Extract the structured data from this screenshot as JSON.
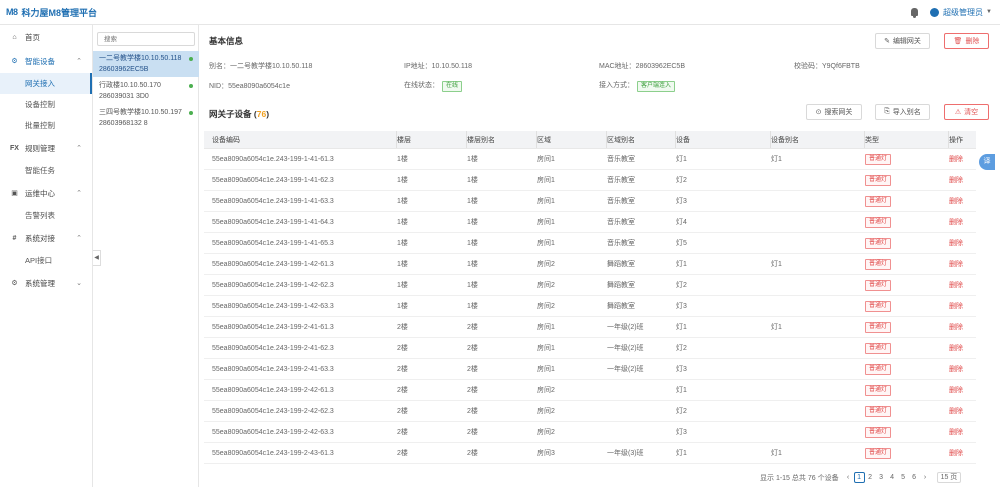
{
  "app": {
    "logo": "M8",
    "title": "科力屋M8管理平台",
    "user": "超级管理员"
  },
  "nav": {
    "home": "首页",
    "smart": "智能设备",
    "gateway_access": "网关接入",
    "device_control": "设备控制",
    "batch_control": "批量控制",
    "rules": "规则管理",
    "smart_tasks": "智能任务",
    "ops": "运维中心",
    "alarms": "告警列表",
    "integration": "系统对接",
    "api": "API接口",
    "system": "系统管理",
    "rules_prefix": "FX"
  },
  "gateways": {
    "search_placeholder": "搜索",
    "items": [
      {
        "name": "一二号教学楼10.10.50.118",
        "mac": "28603962EC5B"
      },
      {
        "name": "行政楼10.10.50.170",
        "mac": "286039031 3D0"
      },
      {
        "name": "三四号教学楼10.10.50.197",
        "mac": "28603968132 8"
      }
    ]
  },
  "basic": {
    "title": "基本信息",
    "edit_btn": "编辑网关",
    "delete_btn": "删除",
    "alias_label": "别名：",
    "alias": "一二号教学楼10.10.50.118",
    "ip_label": "IP地址：",
    "ip": "10.10.50.118",
    "mac_label": "MAC地址：",
    "mac": "28603962EC5B",
    "check_label": "校验码：",
    "check": "Y9Qf6FBTB",
    "nid_label": "NID：",
    "nid": "55ea8090a6054c1e",
    "status_label": "在线状态：",
    "status": "在线",
    "access_label": "接入方式：",
    "access": "客户端连入"
  },
  "sub": {
    "title": "网关子设备",
    "count": "76",
    "search_btn": "搜索网关",
    "import_btn": "导入别名",
    "clear_btn": "清空"
  },
  "table": {
    "headers": [
      "设备编码",
      "楼层",
      "楼层别名",
      "区域",
      "区域别名",
      "设备",
      "设备别名",
      "类型",
      "操作"
    ],
    "type_label": "普通灯",
    "op_label": "删除",
    "rows": [
      {
        "code": "55ea8090a6054c1e.243-199-1-41-61.3",
        "floor": "1楼",
        "floor_alias": "1楼",
        "area": "房间1",
        "area_alias": "音乐教室",
        "device": "灯1",
        "device_alias": "灯1"
      },
      {
        "code": "55ea8090a6054c1e.243-199-1-41-62.3",
        "floor": "1楼",
        "floor_alias": "1楼",
        "area": "房间1",
        "area_alias": "音乐教室",
        "device": "灯2",
        "device_alias": ""
      },
      {
        "code": "55ea8090a6054c1e.243-199-1-41-63.3",
        "floor": "1楼",
        "floor_alias": "1楼",
        "area": "房间1",
        "area_alias": "音乐教室",
        "device": "灯3",
        "device_alias": ""
      },
      {
        "code": "55ea8090a6054c1e.243-199-1-41-64.3",
        "floor": "1楼",
        "floor_alias": "1楼",
        "area": "房间1",
        "area_alias": "音乐教室",
        "device": "灯4",
        "device_alias": ""
      },
      {
        "code": "55ea8090a6054c1e.243-199-1-41-65.3",
        "floor": "1楼",
        "floor_alias": "1楼",
        "area": "房间1",
        "area_alias": "音乐教室",
        "device": "灯5",
        "device_alias": ""
      },
      {
        "code": "55ea8090a6054c1e.243-199-1-42-61.3",
        "floor": "1楼",
        "floor_alias": "1楼",
        "area": "房间2",
        "area_alias": "舞蹈教室",
        "device": "灯1",
        "device_alias": "灯1"
      },
      {
        "code": "55ea8090a6054c1e.243-199-1-42-62.3",
        "floor": "1楼",
        "floor_alias": "1楼",
        "area": "房间2",
        "area_alias": "舞蹈教室",
        "device": "灯2",
        "device_alias": ""
      },
      {
        "code": "55ea8090a6054c1e.243-199-1-42-63.3",
        "floor": "1楼",
        "floor_alias": "1楼",
        "area": "房间2",
        "area_alias": "舞蹈教室",
        "device": "灯3",
        "device_alias": ""
      },
      {
        "code": "55ea8090a6054c1e.243-199-2-41-61.3",
        "floor": "2楼",
        "floor_alias": "2楼",
        "area": "房间1",
        "area_alias": "一年级(2)班",
        "device": "灯1",
        "device_alias": "灯1"
      },
      {
        "code": "55ea8090a6054c1e.243-199-2-41-62.3",
        "floor": "2楼",
        "floor_alias": "2楼",
        "area": "房间1",
        "area_alias": "一年级(2)班",
        "device": "灯2",
        "device_alias": ""
      },
      {
        "code": "55ea8090a6054c1e.243-199-2-41-63.3",
        "floor": "2楼",
        "floor_alias": "2楼",
        "area": "房间1",
        "area_alias": "一年级(2)班",
        "device": "灯3",
        "device_alias": ""
      },
      {
        "code": "55ea8090a6054c1e.243-199-2-42-61.3",
        "floor": "2楼",
        "floor_alias": "2楼",
        "area": "房间2",
        "area_alias": "",
        "device": "灯1",
        "device_alias": ""
      },
      {
        "code": "55ea8090a6054c1e.243-199-2-42-62.3",
        "floor": "2楼",
        "floor_alias": "2楼",
        "area": "房间2",
        "area_alias": "",
        "device": "灯2",
        "device_alias": ""
      },
      {
        "code": "55ea8090a6054c1e.243-199-2-42-63.3",
        "floor": "2楼",
        "floor_alias": "2楼",
        "area": "房间2",
        "area_alias": "",
        "device": "灯3",
        "device_alias": ""
      },
      {
        "code": "55ea8090a6054c1e.243-199-2-43-61.3",
        "floor": "2楼",
        "floor_alias": "2楼",
        "area": "房间3",
        "area_alias": "一年级(3)班",
        "device": "灯1",
        "device_alias": "灯1"
      }
    ]
  },
  "pager": {
    "summary": "显示 1-15 总共 76 个设备",
    "pages": [
      "1",
      "2",
      "3",
      "4",
      "5",
      "6"
    ],
    "next": "›",
    "prev": "‹",
    "page_size": "15 页"
  },
  "side_tab": "译"
}
